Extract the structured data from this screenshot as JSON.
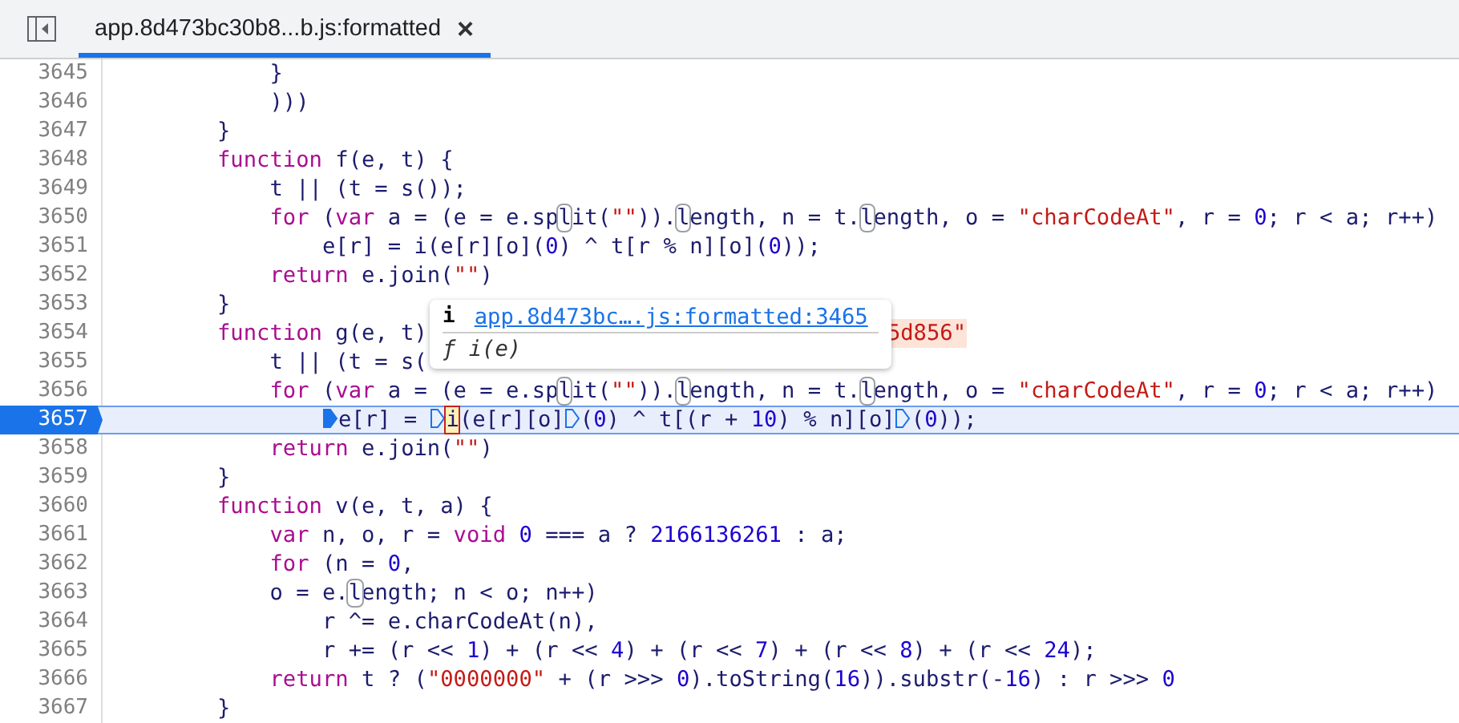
{
  "tab_bar": {
    "tabs": [
      {
        "label": "app.8d473bc30b8...b.js:formatted",
        "close": "×",
        "selected": true
      }
    ]
  },
  "lines": [
    {
      "number": "3645",
      "paused": false,
      "tokens": [
        {
          "kind": "c",
          "t": "            }"
        }
      ]
    },
    {
      "number": "3646",
      "paused": false,
      "tokens": [
        {
          "kind": "c",
          "t": "            )))"
        }
      ]
    },
    {
      "number": "3647",
      "paused": false,
      "tokens": [
        {
          "kind": "c",
          "t": "        }"
        }
      ]
    },
    {
      "number": "3648",
      "paused": false,
      "tokens": [
        {
          "kind": "kw",
          "t": "        function"
        },
        {
          "kind": "c",
          "t": " f(e, t) {"
        }
      ]
    },
    {
      "number": "3649",
      "paused": false,
      "tokens": [
        {
          "kind": "c",
          "t": "            t || (t = s());"
        }
      ]
    },
    {
      "number": "3650",
      "paused": false,
      "tokens": [
        {
          "kind": "kw",
          "t": "            for"
        },
        {
          "kind": "c",
          "t": " ("
        },
        {
          "kind": "kw",
          "t": "var"
        },
        {
          "kind": "c",
          "t": " a = (e = e.sp"
        },
        {
          "kind": "boxed",
          "t": "l"
        },
        {
          "kind": "c",
          "t": "it("
        },
        {
          "kind": "str",
          "t": "\"\""
        },
        {
          "kind": "c",
          "t": "))."
        },
        {
          "kind": "boxed",
          "t": "l"
        },
        {
          "kind": "c",
          "t": "ength, n = t."
        },
        {
          "kind": "boxed",
          "t": "l"
        },
        {
          "kind": "c",
          "t": "ength, o = "
        },
        {
          "kind": "str",
          "t": "\"charCodeAt\""
        },
        {
          "kind": "c",
          "t": ", r = "
        },
        {
          "kind": "num",
          "t": "0"
        },
        {
          "kind": "c",
          "t": "; r < a; r++)"
        }
      ]
    },
    {
      "number": "3651",
      "paused": false,
      "tokens": [
        {
          "kind": "c",
          "t": "                e[r] = i(e[r][o]("
        },
        {
          "kind": "num",
          "t": "0"
        },
        {
          "kind": "c",
          "t": ") ^ t[r % n][o]("
        },
        {
          "kind": "num",
          "t": "0"
        },
        {
          "kind": "c",
          "t": "));"
        }
      ]
    },
    {
      "number": "3652",
      "paused": false,
      "tokens": [
        {
          "kind": "kw",
          "t": "            return"
        },
        {
          "kind": "c",
          "t": " e.join("
        },
        {
          "kind": "str",
          "t": "\"\""
        },
        {
          "kind": "c",
          "t": ")"
        }
      ]
    },
    {
      "number": "3653",
      "paused": false,
      "tokens": [
        {
          "kind": "c",
          "t": "        }"
        }
      ]
    },
    {
      "number": "3654",
      "paused": false,
      "tokens": [
        {
          "kind": "kw",
          "t": "        function"
        },
        {
          "kind": "c",
          "t": " g(e, t)"
        },
        {
          "kind": "tail",
          "t": "5d856\""
        }
      ]
    },
    {
      "number": "3655",
      "paused": false,
      "tokens": [
        {
          "kind": "c",
          "t": "            t || (t = s("
        }
      ]
    },
    {
      "number": "3656",
      "paused": false,
      "tokens": [
        {
          "kind": "kw",
          "t": "            for"
        },
        {
          "kind": "c",
          "t": " ("
        },
        {
          "kind": "kw",
          "t": "var"
        },
        {
          "kind": "c",
          "t": " a = (e = e.sp"
        },
        {
          "kind": "boxed",
          "t": "l"
        },
        {
          "kind": "c",
          "t": "it("
        },
        {
          "kind": "str",
          "t": "\"\""
        },
        {
          "kind": "c",
          "t": "))."
        },
        {
          "kind": "boxed",
          "t": "l"
        },
        {
          "kind": "c",
          "t": "ength, n = t."
        },
        {
          "kind": "boxed",
          "t": "l"
        },
        {
          "kind": "c",
          "t": "ength, o = "
        },
        {
          "kind": "str",
          "t": "\"charCodeAt\""
        },
        {
          "kind": "c",
          "t": ", r = "
        },
        {
          "kind": "num",
          "t": "0"
        },
        {
          "kind": "c",
          "t": "; r < a; r++)"
        }
      ]
    },
    {
      "number": "3657",
      "paused": true,
      "tokens": [
        {
          "kind": "c",
          "t": "                e[r] = ",
          "marker": {
            "active": true
          }
        },
        {
          "kind": "current",
          "t": "i",
          "marker": {
            "active": false
          }
        },
        {
          "kind": "c",
          "t": "(e[r][o]"
        },
        {
          "kind": "c",
          "t": "(",
          "marker": {
            "active": false
          }
        },
        {
          "kind": "num",
          "t": "0"
        },
        {
          "kind": "c",
          "t": ") ^ t[(r + "
        },
        {
          "kind": "num",
          "t": "10"
        },
        {
          "kind": "c",
          "t": ") % n][o]"
        },
        {
          "kind": "c",
          "t": "(",
          "marker": {
            "active": false
          }
        },
        {
          "kind": "num",
          "t": "0"
        },
        {
          "kind": "c",
          "t": "));"
        }
      ]
    },
    {
      "number": "3658",
      "paused": false,
      "tokens": [
        {
          "kind": "kw",
          "t": "            return"
        },
        {
          "kind": "c",
          "t": " e.join("
        },
        {
          "kind": "str",
          "t": "\"\""
        },
        {
          "kind": "c",
          "t": ")"
        }
      ]
    },
    {
      "number": "3659",
      "paused": false,
      "tokens": [
        {
          "kind": "c",
          "t": "        }"
        }
      ]
    },
    {
      "number": "3660",
      "paused": false,
      "tokens": [
        {
          "kind": "kw",
          "t": "        function"
        },
        {
          "kind": "c",
          "t": " v(e, t, a) {"
        }
      ]
    },
    {
      "number": "3661",
      "paused": false,
      "tokens": [
        {
          "kind": "kw",
          "t": "            var"
        },
        {
          "kind": "c",
          "t": " n, o, r = "
        },
        {
          "kind": "kw",
          "t": "void"
        },
        {
          "kind": "num",
          "t": " 0"
        },
        {
          "kind": "c",
          "t": " === a ? "
        },
        {
          "kind": "num",
          "t": "2166136261"
        },
        {
          "kind": "c",
          "t": " : a;"
        }
      ]
    },
    {
      "number": "3662",
      "paused": false,
      "tokens": [
        {
          "kind": "kw",
          "t": "            for"
        },
        {
          "kind": "c",
          "t": " (n = "
        },
        {
          "kind": "num",
          "t": "0"
        },
        {
          "kind": "c",
          "t": ","
        }
      ]
    },
    {
      "number": "3663",
      "paused": false,
      "tokens": [
        {
          "kind": "c",
          "t": "            o = e."
        },
        {
          "kind": "boxed",
          "t": "l"
        },
        {
          "kind": "c",
          "t": "ength; n < o; n++)"
        }
      ]
    },
    {
      "number": "3664",
      "paused": false,
      "tokens": [
        {
          "kind": "c",
          "t": "                r ^= e.charCodeAt(n),"
        }
      ]
    },
    {
      "number": "3665",
      "paused": false,
      "tokens": [
        {
          "kind": "c",
          "t": "                r += (r << "
        },
        {
          "kind": "num",
          "t": "1"
        },
        {
          "kind": "c",
          "t": ") + (r << "
        },
        {
          "kind": "num",
          "t": "4"
        },
        {
          "kind": "c",
          "t": ") + (r << "
        },
        {
          "kind": "num",
          "t": "7"
        },
        {
          "kind": "c",
          "t": ") + (r << "
        },
        {
          "kind": "num",
          "t": "8"
        },
        {
          "kind": "c",
          "t": ") + (r << "
        },
        {
          "kind": "num",
          "t": "24"
        },
        {
          "kind": "c",
          "t": ");"
        }
      ]
    },
    {
      "number": "3666",
      "paused": false,
      "tokens": [
        {
          "kind": "kw",
          "t": "            return"
        },
        {
          "kind": "c",
          "t": " t ? ("
        },
        {
          "kind": "str",
          "t": "\"0000000\""
        },
        {
          "kind": "c",
          "t": " + (r >>> "
        },
        {
          "kind": "num",
          "t": "0"
        },
        {
          "kind": "c",
          "t": ").toString("
        },
        {
          "kind": "num",
          "t": "16"
        },
        {
          "kind": "c",
          "t": ")).substr(-"
        },
        {
          "kind": "num",
          "t": "16"
        },
        {
          "kind": "c",
          "t": ") : r >>> "
        },
        {
          "kind": "num",
          "t": "0"
        }
      ]
    },
    {
      "number": "3667",
      "paused": false,
      "tokens": [
        {
          "kind": "c",
          "t": "        }"
        }
      ]
    }
  ],
  "tooltip": {
    "badge": "i",
    "link": "app.8d473bc….js:formatted:3465",
    "signature": "ƒ i(e)"
  }
}
